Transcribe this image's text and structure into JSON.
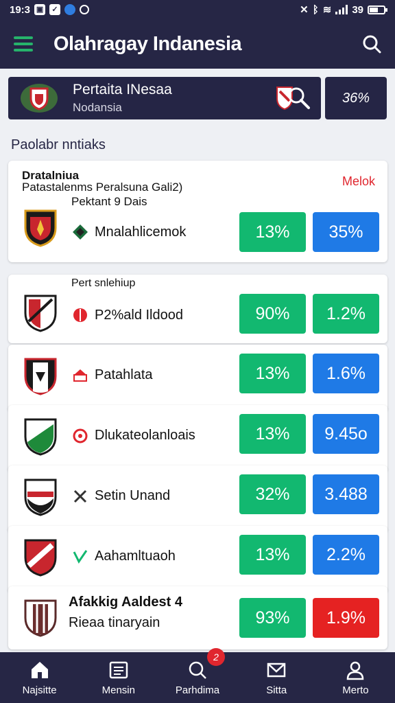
{
  "status_bar": {
    "time": "19:3",
    "right_text": "39"
  },
  "app_bar": {
    "title": "Olahragay Indanesia"
  },
  "banner": {
    "title": "Pertaita INesaa",
    "subtitle": "Nodansia",
    "right_value": "36%"
  },
  "section": {
    "title": "Paolabr nntiaks"
  },
  "featured": {
    "title": "Dratalniua",
    "subtitle": "Patastalenms Peralsuna Gali2)",
    "subtitle2": "Pektant 9 Dais",
    "link": "Melok",
    "team": "Mnalahlicemok",
    "pct_a": "13%",
    "pct_b": "35%"
  },
  "rows": [
    {
      "header": "Pert snlehiup",
      "team": "P2%ald Ildood",
      "pct_a": "90%",
      "pct_b": "1.2%"
    },
    {
      "team": "Patahlata",
      "pct_a": "13%",
      "pct_b": "1.6%"
    },
    {
      "team": "Dlukateolanloais",
      "pct_a": "13%",
      "pct_b": "9.45o"
    },
    {
      "team": "Setin Unand",
      "pct_a": "32%",
      "pct_b": "3.488"
    },
    {
      "team": "Aahamltuaoh",
      "pct_a": "13%",
      "pct_b": "2.2%"
    }
  ],
  "last_card": {
    "title": "Afakkig Aaldest 4",
    "subtitle": "Rieaa tinaryain",
    "pct_a": "93%",
    "pct_b": "1.9%"
  },
  "tabs": [
    {
      "label": "Najsitte",
      "icon": "home-icon"
    },
    {
      "label": "Mensin",
      "icon": "news-icon"
    },
    {
      "label": "Parhdima",
      "icon": "search-icon",
      "badge": "2"
    },
    {
      "label": "Sitta",
      "icon": "mail-icon"
    },
    {
      "label": "Merto",
      "icon": "user-icon"
    }
  ],
  "colors": {
    "primary": "#262645",
    "green": "#12b870",
    "blue": "#1f7ae6",
    "red": "#e52222",
    "menu_green": "#26b36b"
  }
}
